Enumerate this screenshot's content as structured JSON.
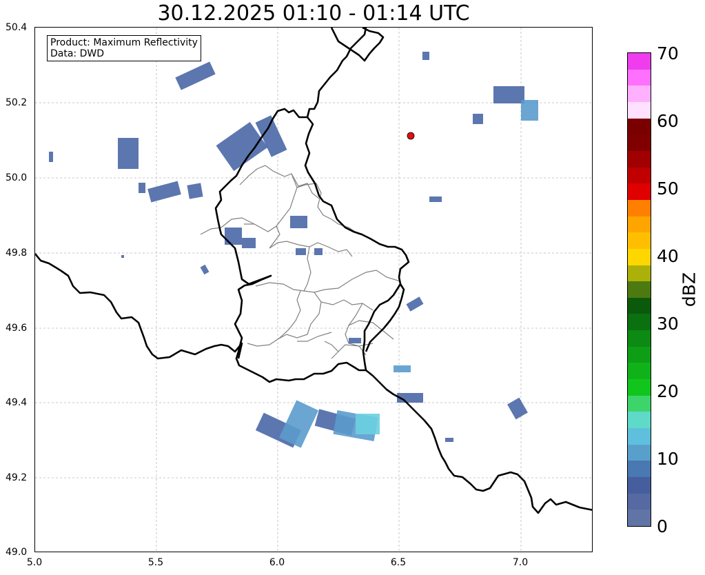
{
  "title": "30.12.2025 01:10 - 01:14 UTC",
  "info_box": {
    "product": "Product: Maximum Reflectivity",
    "data": "Data: DWD"
  },
  "x_ticks": [
    "5.0",
    "5.5",
    "6.0",
    "6.5",
    "7.0"
  ],
  "y_ticks": [
    "50.4",
    "50.2",
    "50.0",
    "49.8",
    "49.6",
    "49.4",
    "49.2",
    "49.0"
  ],
  "colorbar": {
    "unit": "dBZ",
    "labels": [
      "0",
      "10",
      "20",
      "30",
      "40",
      "50",
      "60",
      "70"
    ],
    "colors": [
      "#6174a6",
      "#5669a2",
      "#465e9d",
      "#4a78b2",
      "#58a0cb",
      "#5ec0dc",
      "#5fd9c8",
      "#3dd56b",
      "#11c51d",
      "#10b21a",
      "#0d9e16",
      "#0c8a13",
      "#0a7010",
      "#0b5a0c",
      "#4c7a10",
      "#acb10a",
      "#ffd700",
      "#ffbf00",
      "#ffa500",
      "#ff8000",
      "#e00000",
      "#c00000",
      "#a00000",
      "#800000",
      "#7a0000",
      "#ffe0ff",
      "#ffb0ff",
      "#ff70ff",
      "#ee3cee"
    ]
  },
  "map": {
    "extent_lon": [
      5.0,
      7.3
    ],
    "extent_lat": [
      49.0,
      50.4
    ],
    "marker": {
      "lon": 6.55,
      "lat": 50.11,
      "color": "#e01010"
    },
    "echo_colors": {
      "weak": "#4a67a6",
      "mid": "#5b9bcc",
      "strong": "#6ccfe0"
    }
  }
}
